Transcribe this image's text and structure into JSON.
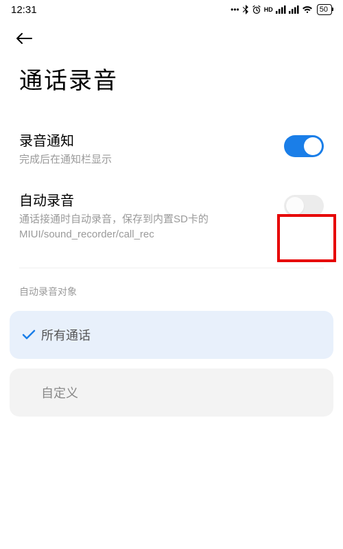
{
  "status_bar": {
    "time": "12:31",
    "hd_label": "HD",
    "battery": "50"
  },
  "header": {
    "title": "通话录音"
  },
  "settings": [
    {
      "label": "录音通知",
      "desc": "完成后在通知栏显示",
      "enabled": true
    },
    {
      "label": "自动录音",
      "desc": "通话接通时自动录音，保存到内置SD卡的MIUI/sound_recorder/call_rec",
      "enabled": false
    }
  ],
  "auto_record": {
    "section_title": "自动录音对象",
    "options": [
      {
        "label": "所有通话",
        "selected": true
      },
      {
        "label": "自定义",
        "selected": false
      }
    ]
  }
}
